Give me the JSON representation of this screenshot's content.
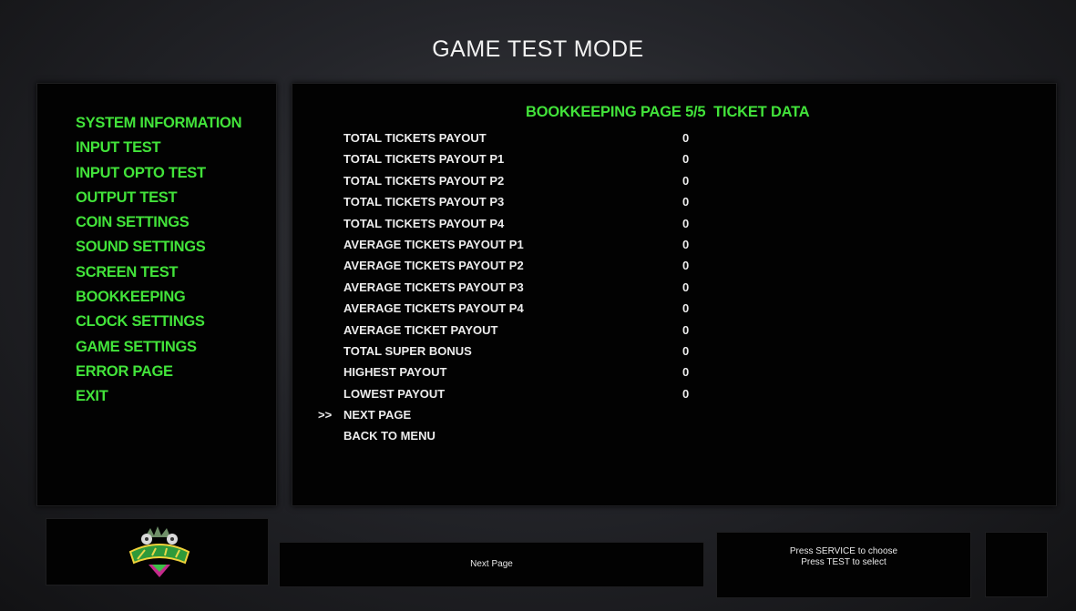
{
  "title": "GAME TEST MODE",
  "menu": {
    "items": [
      "SYSTEM INFORMATION",
      "INPUT TEST",
      "INPUT OPTO TEST",
      "OUTPUT TEST",
      "COIN SETTINGS",
      "SOUND SETTINGS",
      "SCREEN TEST",
      "BOOKKEEPING",
      "CLOCK SETTINGS",
      "GAME SETTINGS",
      "ERROR PAGE",
      "EXIT"
    ]
  },
  "page": {
    "header": "BOOKKEEPING PAGE 5/5  TICKET DATA",
    "rows": [
      {
        "label": "TOTAL TICKETS PAYOUT",
        "value": "0"
      },
      {
        "label": "TOTAL TICKETS PAYOUT P1",
        "value": "0"
      },
      {
        "label": "TOTAL TICKETS PAYOUT P2",
        "value": "0"
      },
      {
        "label": "TOTAL TICKETS PAYOUT P3",
        "value": "0"
      },
      {
        "label": "TOTAL TICKETS PAYOUT P4",
        "value": "0"
      },
      {
        "label": "AVERAGE TICKETS PAYOUT P1",
        "value": "0"
      },
      {
        "label": "AVERAGE TICKETS PAYOUT P2",
        "value": "0"
      },
      {
        "label": "AVERAGE TICKETS PAYOUT P3",
        "value": "0"
      },
      {
        "label": "AVERAGE TICKETS PAYOUT P4",
        "value": "0"
      },
      {
        "label": "AVERAGE TICKET PAYOUT",
        "value": "0"
      },
      {
        "label": "TOTAL SUPER BONUS",
        "value": "0"
      },
      {
        "label": "HIGHEST PAYOUT",
        "value": "0"
      },
      {
        "label": "LOWEST PAYOUT",
        "value": "0"
      }
    ],
    "actions": [
      "NEXT PAGE",
      "BACK TO MENU"
    ],
    "cursor_indicator": ">>"
  },
  "footer": {
    "logo_icon": "zombies-logo-icon",
    "hint": "Next Page",
    "instructions": [
      "Press SERVICE to choose",
      "Press TEST to select"
    ]
  },
  "colors": {
    "menu_text": "#42e33a",
    "body_text": "#ececec",
    "panel_bg": "#020202"
  }
}
